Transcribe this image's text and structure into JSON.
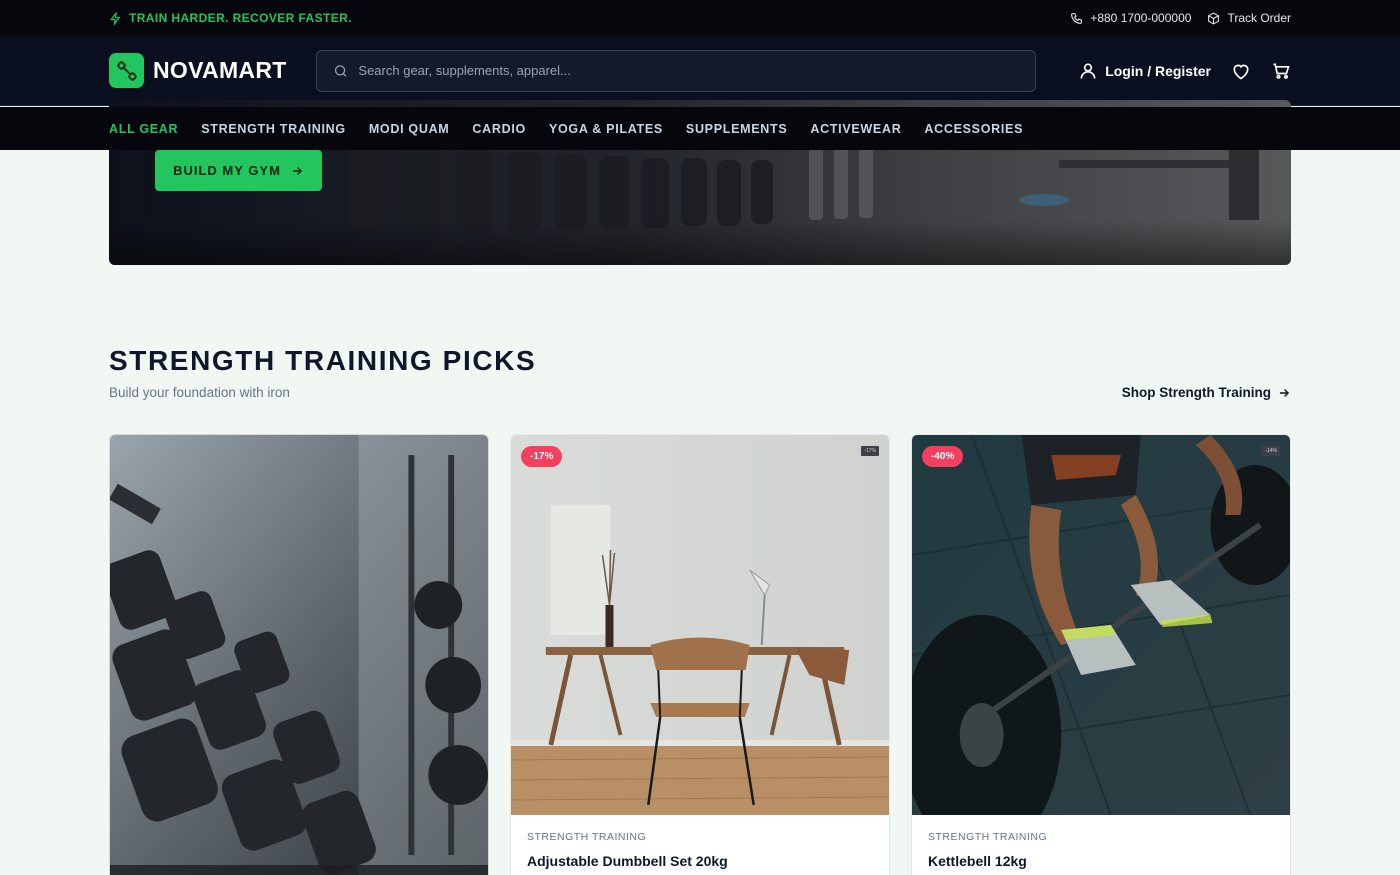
{
  "topbar": {
    "promo": "TRAIN HARDER. RECOVER FASTER.",
    "phone": "+880 1700-000000",
    "track_order": "Track Order"
  },
  "header": {
    "brand": "NOVAMART",
    "search_placeholder": "Search gear, supplements, apparel...",
    "login": "Login / Register"
  },
  "nav": {
    "items": [
      "ALL GEAR",
      "STRENGTH TRAINING",
      "MODI QUAM",
      "CARDIO",
      "YOGA & PILATES",
      "SUPPLEMENTS",
      "ACTIVEWEAR",
      "ACCESSORIES"
    ],
    "active": "ALL GEAR"
  },
  "hero": {
    "cta": "BUILD MY GYM"
  },
  "section": {
    "title": "STRENGTH TRAINING PICKS",
    "subtitle": "Build your foundation with iron",
    "link": "Shop Strength Training"
  },
  "products": [
    {
      "image": "dumbbell-rack-photo",
      "badge": "",
      "category": "",
      "name": ""
    },
    {
      "image": "desk-chair-photo",
      "badge": "-17%",
      "mini_tag": "-17%",
      "category": "STRENGTH TRAINING",
      "name": "Adjustable Dumbbell Set 20kg"
    },
    {
      "image": "barbell-lift-photo",
      "badge": "-40%",
      "mini_tag": "-14%",
      "category": "STRENGTH TRAINING",
      "name": "Kettlebell 12kg"
    }
  ],
  "colors": {
    "accent": "#22c55e",
    "badge": "#f43f5e",
    "dark": "#05070d",
    "page_bg": "#f1f8f4"
  }
}
